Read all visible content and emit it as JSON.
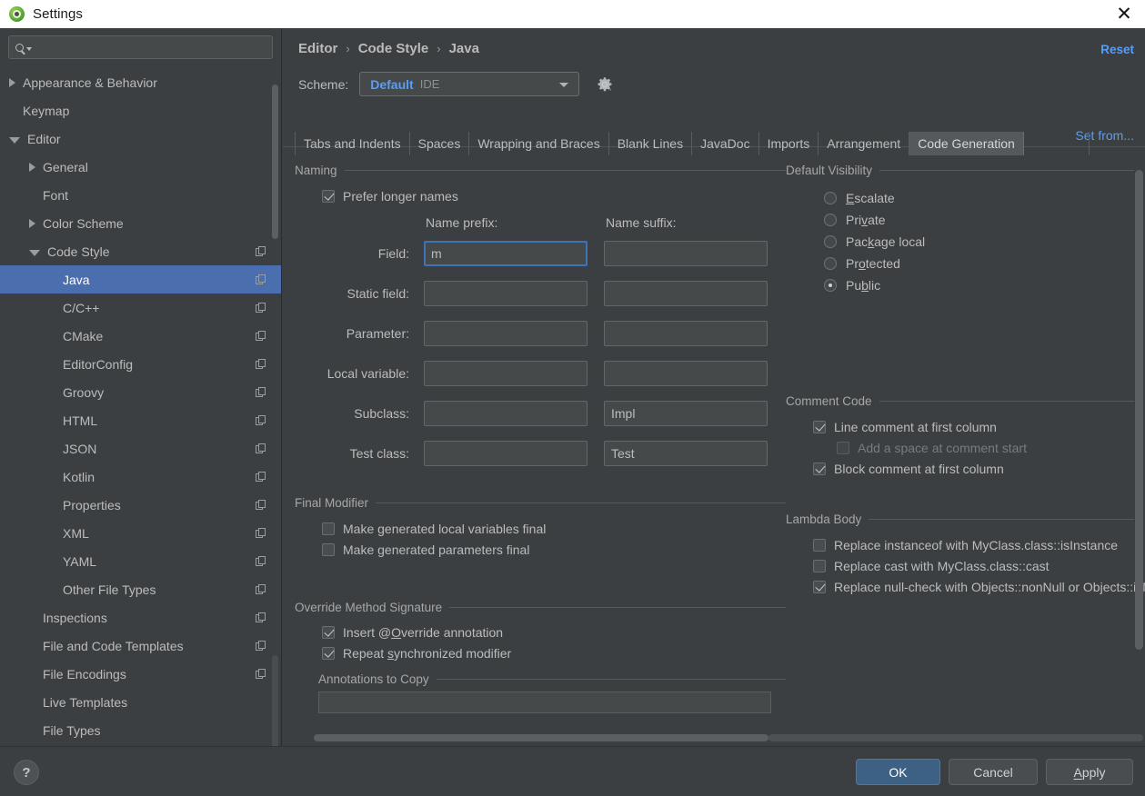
{
  "window": {
    "title": "Settings",
    "close_icon": "close-icon",
    "app_icon": "intellij-logo-icon"
  },
  "sidebar": {
    "search": {
      "placeholder": "",
      "value": "",
      "icon": "search-icon"
    },
    "items": [
      {
        "label": "Appearance & Behavior",
        "indent": 0,
        "toggle": "collapsed",
        "copy": false,
        "selected": false
      },
      {
        "label": "Keymap",
        "indent": 0,
        "toggle": "none",
        "copy": false,
        "selected": false
      },
      {
        "label": "Editor",
        "indent": 0,
        "toggle": "expanded",
        "copy": false,
        "selected": false
      },
      {
        "label": "General",
        "indent": 1,
        "toggle": "collapsed",
        "copy": false,
        "selected": false
      },
      {
        "label": "Font",
        "indent": 1,
        "toggle": "none",
        "copy": false,
        "selected": false
      },
      {
        "label": "Color Scheme",
        "indent": 1,
        "toggle": "collapsed",
        "copy": false,
        "selected": false
      },
      {
        "label": "Code Style",
        "indent": 1,
        "toggle": "expanded",
        "copy": true,
        "selected": false
      },
      {
        "label": "Java",
        "indent": 2,
        "toggle": "none",
        "copy": true,
        "selected": true
      },
      {
        "label": "C/C++",
        "indent": 2,
        "toggle": "none",
        "copy": true,
        "selected": false
      },
      {
        "label": "CMake",
        "indent": 2,
        "toggle": "none",
        "copy": true,
        "selected": false
      },
      {
        "label": "EditorConfig",
        "indent": 2,
        "toggle": "none",
        "copy": true,
        "selected": false
      },
      {
        "label": "Groovy",
        "indent": 2,
        "toggle": "none",
        "copy": true,
        "selected": false
      },
      {
        "label": "HTML",
        "indent": 2,
        "toggle": "none",
        "copy": true,
        "selected": false
      },
      {
        "label": "JSON",
        "indent": 2,
        "toggle": "none",
        "copy": true,
        "selected": false
      },
      {
        "label": "Kotlin",
        "indent": 2,
        "toggle": "none",
        "copy": true,
        "selected": false
      },
      {
        "label": "Properties",
        "indent": 2,
        "toggle": "none",
        "copy": true,
        "selected": false
      },
      {
        "label": "XML",
        "indent": 2,
        "toggle": "none",
        "copy": true,
        "selected": false
      },
      {
        "label": "YAML",
        "indent": 2,
        "toggle": "none",
        "copy": true,
        "selected": false
      },
      {
        "label": "Other File Types",
        "indent": 2,
        "toggle": "none",
        "copy": true,
        "selected": false
      },
      {
        "label": "Inspections",
        "indent": 1,
        "toggle": "none",
        "copy": true,
        "selected": false
      },
      {
        "label": "File and Code Templates",
        "indent": 1,
        "toggle": "none",
        "copy": true,
        "selected": false
      },
      {
        "label": "File Encodings",
        "indent": 1,
        "toggle": "none",
        "copy": true,
        "selected": false
      },
      {
        "label": "Live Templates",
        "indent": 1,
        "toggle": "none",
        "copy": false,
        "selected": false
      },
      {
        "label": "File Types",
        "indent": 1,
        "toggle": "none",
        "copy": false,
        "selected": false
      }
    ]
  },
  "header": {
    "breadcrumb": [
      "Editor",
      "Code Style",
      "Java"
    ],
    "separator": "›",
    "reset_label": "Reset",
    "scheme_label": "Scheme:",
    "scheme_value": "Default",
    "scheme_scope": "IDE",
    "gear_icon": "gear-icon",
    "set_from_label": "Set from..."
  },
  "tabs": {
    "items": [
      "Tabs and Indents",
      "Spaces",
      "Wrapping and Braces",
      "Blank Lines",
      "JavaDoc",
      "Imports",
      "Arrangement",
      "Code Generation"
    ],
    "active": "Code Generation"
  },
  "naming": {
    "title": "Naming",
    "prefer_longer": {
      "label": "Prefer longer names",
      "checked": true
    },
    "col_prefix": "Name prefix:",
    "col_suffix": "Name suffix:",
    "rows": [
      {
        "label": "Field:",
        "prefix": "m",
        "suffix": "",
        "focused": true
      },
      {
        "label": "Static field:",
        "prefix": "",
        "suffix": "",
        "focused": false
      },
      {
        "label": "Parameter:",
        "prefix": "",
        "suffix": "",
        "focused": false
      },
      {
        "label": "Local variable:",
        "prefix": "",
        "suffix": "",
        "focused": false
      },
      {
        "label": "Subclass:",
        "prefix": "",
        "suffix": "Impl",
        "focused": false
      },
      {
        "label": "Test class:",
        "prefix": "",
        "suffix": "Test",
        "focused": false
      }
    ]
  },
  "default_visibility": {
    "title": "Default Visibility",
    "options": [
      {
        "label": "Escalate",
        "mnemonic": "E",
        "selected": false
      },
      {
        "label": "Private",
        "mnemonic": "v",
        "selected": false
      },
      {
        "label": "Package local",
        "mnemonic": "k",
        "selected": false
      },
      {
        "label": "Protected",
        "mnemonic": "o",
        "selected": false
      },
      {
        "label": "Public",
        "mnemonic": "b",
        "selected": true
      }
    ]
  },
  "final_modifier": {
    "title": "Final Modifier",
    "options": [
      {
        "label": "Make generated local variables final",
        "checked": false,
        "enabled": true
      },
      {
        "label": "Make generated parameters final",
        "checked": false,
        "enabled": true
      }
    ]
  },
  "comment_code": {
    "title": "Comment Code",
    "options": [
      {
        "label": "Line comment at first column",
        "checked": true,
        "enabled": true,
        "indent": false
      },
      {
        "label": "Add a space at comment start",
        "checked": false,
        "enabled": false,
        "indent": true
      },
      {
        "label": "Block comment at first column",
        "checked": true,
        "enabled": true,
        "indent": false
      }
    ]
  },
  "override_method_signature": {
    "title": "Override Method Signature",
    "options": [
      {
        "label": "Insert @Override annotation",
        "checked": true,
        "mnemonic": "O"
      },
      {
        "label": "Repeat synchronized modifier",
        "checked": true,
        "mnemonic": "s"
      }
    ],
    "annotations_title": "Annotations to Copy"
  },
  "lambda_body": {
    "title": "Lambda Body",
    "options": [
      {
        "label": "Replace instanceof with MyClass.class::isInstance",
        "checked": false
      },
      {
        "label": "Replace cast with MyClass.class::cast",
        "checked": false
      },
      {
        "label": "Replace null-check with Objects::nonNull or Objects::isNull",
        "checked": true
      }
    ]
  },
  "footer": {
    "help_label": "?",
    "ok_label": "OK",
    "cancel_label": "Cancel",
    "apply_label": "Apply",
    "apply_mnemonic": "A"
  },
  "colors": {
    "accent": "#4b6eaf",
    "link": "#589df6",
    "background": "#3c3f41",
    "field_bg": "#45494a",
    "focus_border": "#3d74b8",
    "text": "#bcbcbc"
  }
}
